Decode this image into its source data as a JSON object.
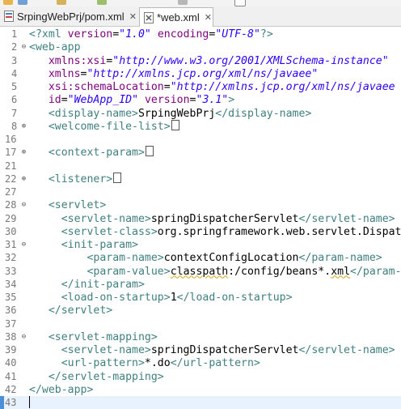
{
  "tabs": [
    {
      "label": "SrpingWebPrj/pom.xml",
      "close": "✕",
      "active": false
    },
    {
      "label": "*web.xml",
      "close": "✕",
      "active": true
    }
  ],
  "lines": [
    {
      "num": "1",
      "fold": "",
      "tokens": [
        [
          "tag",
          "<?xml "
        ],
        [
          "attr",
          "version"
        ],
        [
          "txt",
          "="
        ],
        [
          "val",
          "\"1.0\""
        ],
        [
          "txt",
          " "
        ],
        [
          "attr",
          "encoding"
        ],
        [
          "txt",
          "="
        ],
        [
          "val",
          "\"UTF-8\""
        ],
        [
          "tag",
          "?>"
        ]
      ]
    },
    {
      "num": "2",
      "fold": "⊖",
      "tokens": [
        [
          "tag",
          "<web-app"
        ]
      ]
    },
    {
      "num": "3",
      "fold": "",
      "tokens": [
        [
          "txt",
          "   "
        ],
        [
          "attr",
          "xmlns:xsi"
        ],
        [
          "txt",
          "="
        ],
        [
          "val",
          "\"http://www.w3.org/2001/XMLSchema-instance\""
        ]
      ]
    },
    {
      "num": "4",
      "fold": "",
      "tokens": [
        [
          "txt",
          "   "
        ],
        [
          "attr",
          "xmlns"
        ],
        [
          "txt",
          "="
        ],
        [
          "val",
          "\"http://xmlns.jcp.org/xml/ns/javaee\""
        ]
      ]
    },
    {
      "num": "5",
      "fold": "",
      "tokens": [
        [
          "txt",
          "   "
        ],
        [
          "attr",
          "xsi:schemaLocation"
        ],
        [
          "txt",
          "="
        ],
        [
          "val",
          "\"http://xmlns.jcp.org/xml/ns/javaee http://"
        ]
      ]
    },
    {
      "num": "6",
      "fold": "",
      "tokens": [
        [
          "txt",
          "   "
        ],
        [
          "attr",
          "id"
        ],
        [
          "txt",
          "="
        ],
        [
          "val",
          "\"WebApp_ID\""
        ],
        [
          "txt",
          " "
        ],
        [
          "attr",
          "version"
        ],
        [
          "txt",
          "="
        ],
        [
          "val",
          "\"3.1\""
        ],
        [
          "tag",
          ">"
        ]
      ]
    },
    {
      "num": "7",
      "fold": "",
      "tokens": [
        [
          "txt",
          "   "
        ],
        [
          "tag",
          "<display-name>"
        ],
        [
          "txt",
          "SrpingWebPrj"
        ],
        [
          "tag",
          "</display-name>"
        ]
      ]
    },
    {
      "num": "8",
      "fold": "⊕",
      "tokens": [
        [
          "txt",
          "   "
        ],
        [
          "tag",
          "<welcome-file-list>"
        ],
        [
          "box",
          ""
        ]
      ]
    },
    {
      "num": "16",
      "fold": "",
      "tokens": []
    },
    {
      "num": "17",
      "fold": "⊕",
      "tokens": [
        [
          "txt",
          "   "
        ],
        [
          "tag",
          "<context-param>"
        ],
        [
          "box",
          ""
        ]
      ]
    },
    {
      "num": "21",
      "fold": "",
      "tokens": []
    },
    {
      "num": "22",
      "fold": "⊕",
      "tokens": [
        [
          "txt",
          "   "
        ],
        [
          "tag",
          "<listener>"
        ],
        [
          "box",
          ""
        ]
      ]
    },
    {
      "num": "27",
      "fold": "",
      "tokens": []
    },
    {
      "num": "28",
      "fold": "⊖",
      "tokens": [
        [
          "txt",
          "   "
        ],
        [
          "tag",
          "<servlet>"
        ]
      ]
    },
    {
      "num": "29",
      "fold": "",
      "tokens": [
        [
          "txt",
          "     "
        ],
        [
          "tag",
          "<servlet-name>"
        ],
        [
          "txt",
          "springDispatcherServlet"
        ],
        [
          "tag",
          "</servlet-name>"
        ]
      ]
    },
    {
      "num": "30",
      "fold": "",
      "tokens": [
        [
          "txt",
          "     "
        ],
        [
          "tag",
          "<servlet-class>"
        ],
        [
          "txt",
          "org.springframework.web.servlet.DispatcherSer"
        ]
      ]
    },
    {
      "num": "31",
      "fold": "⊖",
      "tokens": [
        [
          "txt",
          "     "
        ],
        [
          "tag",
          "<init-param>"
        ]
      ]
    },
    {
      "num": "32",
      "fold": "",
      "tokens": [
        [
          "txt",
          "         "
        ],
        [
          "tag",
          "<param-name>"
        ],
        [
          "txt",
          "contextConfigLocation"
        ],
        [
          "tag",
          "</param-name>"
        ]
      ]
    },
    {
      "num": "33",
      "fold": "",
      "tokens": [
        [
          "txt",
          "         "
        ],
        [
          "tag",
          "<param-value>"
        ],
        [
          "sq",
          "classpath"
        ],
        [
          "txt",
          ":/config/beans*."
        ],
        [
          "sq",
          "xml"
        ],
        [
          "tag",
          "</param-value>"
        ]
      ]
    },
    {
      "num": "34",
      "fold": "",
      "tokens": [
        [
          "txt",
          "     "
        ],
        [
          "tag",
          "</init-param>"
        ]
      ]
    },
    {
      "num": "35",
      "fold": "",
      "tokens": [
        [
          "txt",
          "     "
        ],
        [
          "tag",
          "<load-on-startup>"
        ],
        [
          "txt",
          "1"
        ],
        [
          "tag",
          "</load-on-startup>"
        ]
      ]
    },
    {
      "num": "36",
      "fold": "",
      "tokens": [
        [
          "txt",
          "   "
        ],
        [
          "tag",
          "</servlet>"
        ]
      ]
    },
    {
      "num": "37",
      "fold": "",
      "tokens": []
    },
    {
      "num": "38",
      "fold": "⊖",
      "tokens": [
        [
          "txt",
          "   "
        ],
        [
          "tag",
          "<servlet-mapping>"
        ]
      ]
    },
    {
      "num": "39",
      "fold": "",
      "tokens": [
        [
          "txt",
          "     "
        ],
        [
          "tag",
          "<servlet-name>"
        ],
        [
          "txt",
          "springDispatcherServlet"
        ],
        [
          "tag",
          "</servlet-name>"
        ]
      ]
    },
    {
      "num": "40",
      "fold": "",
      "tokens": [
        [
          "txt",
          "     "
        ],
        [
          "tag",
          "<url-pattern>"
        ],
        [
          "txt",
          "*.do"
        ],
        [
          "tag",
          "</url-pattern>"
        ]
      ]
    },
    {
      "num": "41",
      "fold": "",
      "tokens": [
        [
          "txt",
          "   "
        ],
        [
          "tag",
          "</servlet-mapping>"
        ]
      ]
    },
    {
      "num": "42",
      "fold": "",
      "tokens": [
        [
          "tag",
          "</web-app>"
        ]
      ]
    },
    {
      "num": "43",
      "fold": "",
      "tokens": [
        [
          "caret",
          ""
        ]
      ],
      "current": true
    }
  ]
}
